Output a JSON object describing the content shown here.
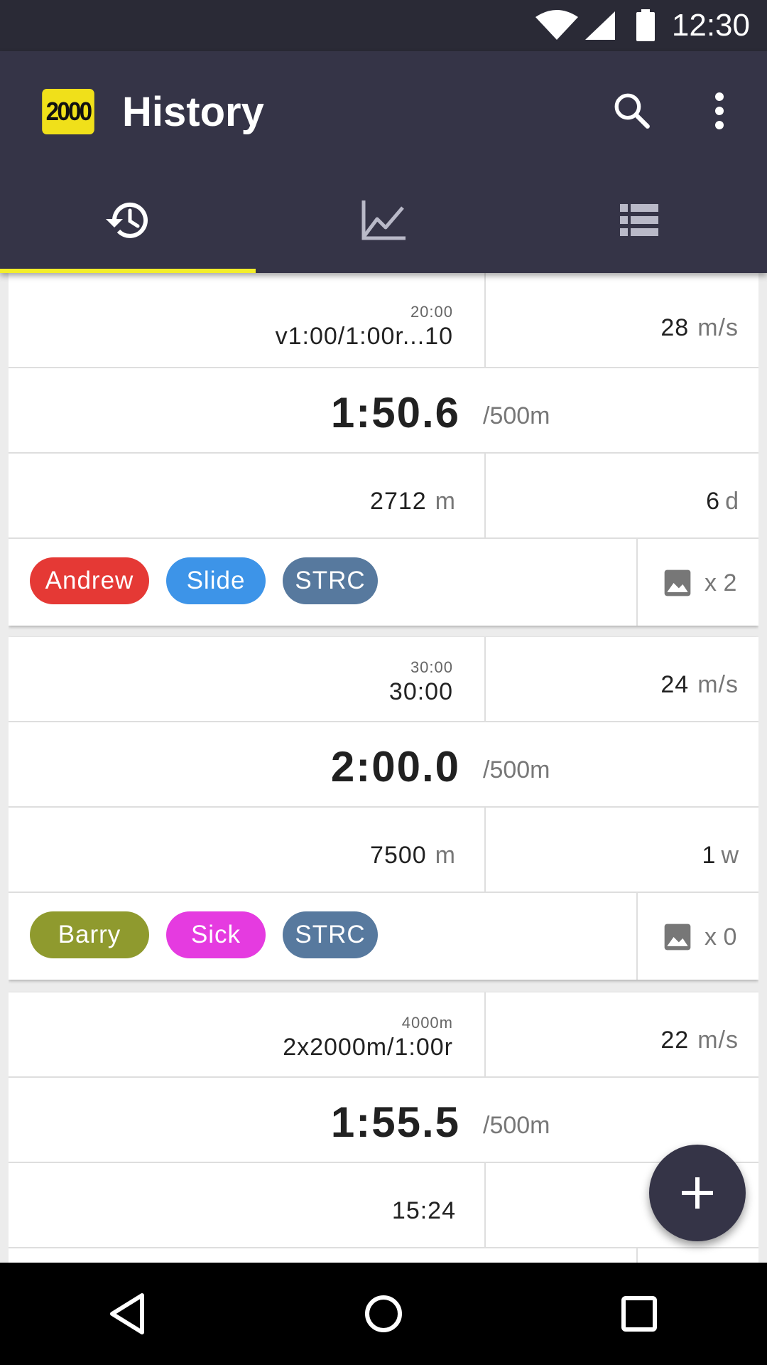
{
  "status_bar": {
    "time": "12:30"
  },
  "app_bar": {
    "logo_text": "2000",
    "title": "History",
    "actions": [
      "search-icon",
      "more-vert-icon"
    ]
  },
  "tabs": [
    {
      "icon": "history-icon",
      "selected": true
    },
    {
      "icon": "line-chart-icon",
      "selected": false
    },
    {
      "icon": "list-icon",
      "selected": false
    }
  ],
  "colors": {
    "appbar": "#353447",
    "accent": "#f3ee2a",
    "tag_andrew": "#e53935",
    "tag_slide": "#3d94e8",
    "tag_strc": "#57799e",
    "tag_barry": "#8f9a2e",
    "tag_sick": "#e53be0"
  },
  "workouts": [
    {
      "total_time": "20:00",
      "description": "v1:00/1:00r...10",
      "stroke_rate": "28",
      "stroke_rate_unit": "m/s",
      "pace": "1:50.6",
      "pace_unit": "/500m",
      "distance": "2712",
      "distance_unit": "m",
      "age_value": "6",
      "age_unit": "d",
      "tags": [
        "Andrew",
        "Slide",
        "STRC"
      ],
      "photo_count": "x 2"
    },
    {
      "total_time": "30:00",
      "description": "30:00",
      "stroke_rate": "24",
      "stroke_rate_unit": "m/s",
      "pace": "2:00.0",
      "pace_unit": "/500m",
      "distance": "7500",
      "distance_unit": "m",
      "age_value": "1",
      "age_unit": "w",
      "tags": [
        "Barry",
        "Sick",
        "STRC"
      ],
      "photo_count": "x 0"
    },
    {
      "total_time": "4000m",
      "description": "2x2000m/1:00r",
      "stroke_rate": "22",
      "stroke_rate_unit": "m/s",
      "pace": "1:55.5",
      "pace_unit": "/500m",
      "time": "15:24"
    }
  ],
  "fab": {
    "icon": "add-icon"
  },
  "nav_bar": [
    "back-icon",
    "home-icon",
    "recents-icon"
  ]
}
